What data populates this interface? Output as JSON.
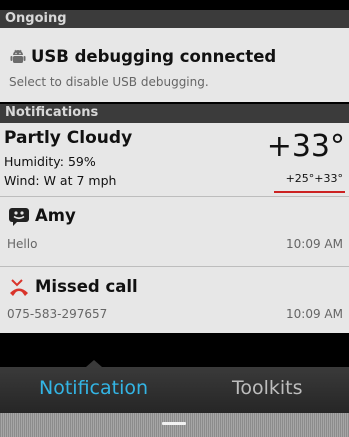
{
  "ongoing": {
    "header": "Ongoing",
    "usb": {
      "title": "USB debugging connected",
      "subtitle": "Select to disable USB debugging.",
      "icon": "android-icon"
    }
  },
  "notifications": {
    "header": "Notifications",
    "weather": {
      "condition": "Partly Cloudy",
      "humidity": "Humidity: 59%",
      "wind": "Wind: W at 7 mph",
      "temperature": "+33°",
      "range": "+25°+33°"
    },
    "items": [
      {
        "title": "Amy",
        "text": "Hello",
        "time": "10:09 AM",
        "icon": "message-icon"
      },
      {
        "title": "Missed call",
        "text": "075-583-297657",
        "time": "10:09 AM",
        "icon": "missed-call-icon"
      }
    ]
  },
  "tabs": [
    {
      "label": "Notification",
      "active": true
    },
    {
      "label": "Toolkits",
      "active": false
    }
  ],
  "colors": {
    "accent": "#33b5e5",
    "inactive_tab": "#bdbdbd",
    "temp_underline": "#cc2222"
  }
}
